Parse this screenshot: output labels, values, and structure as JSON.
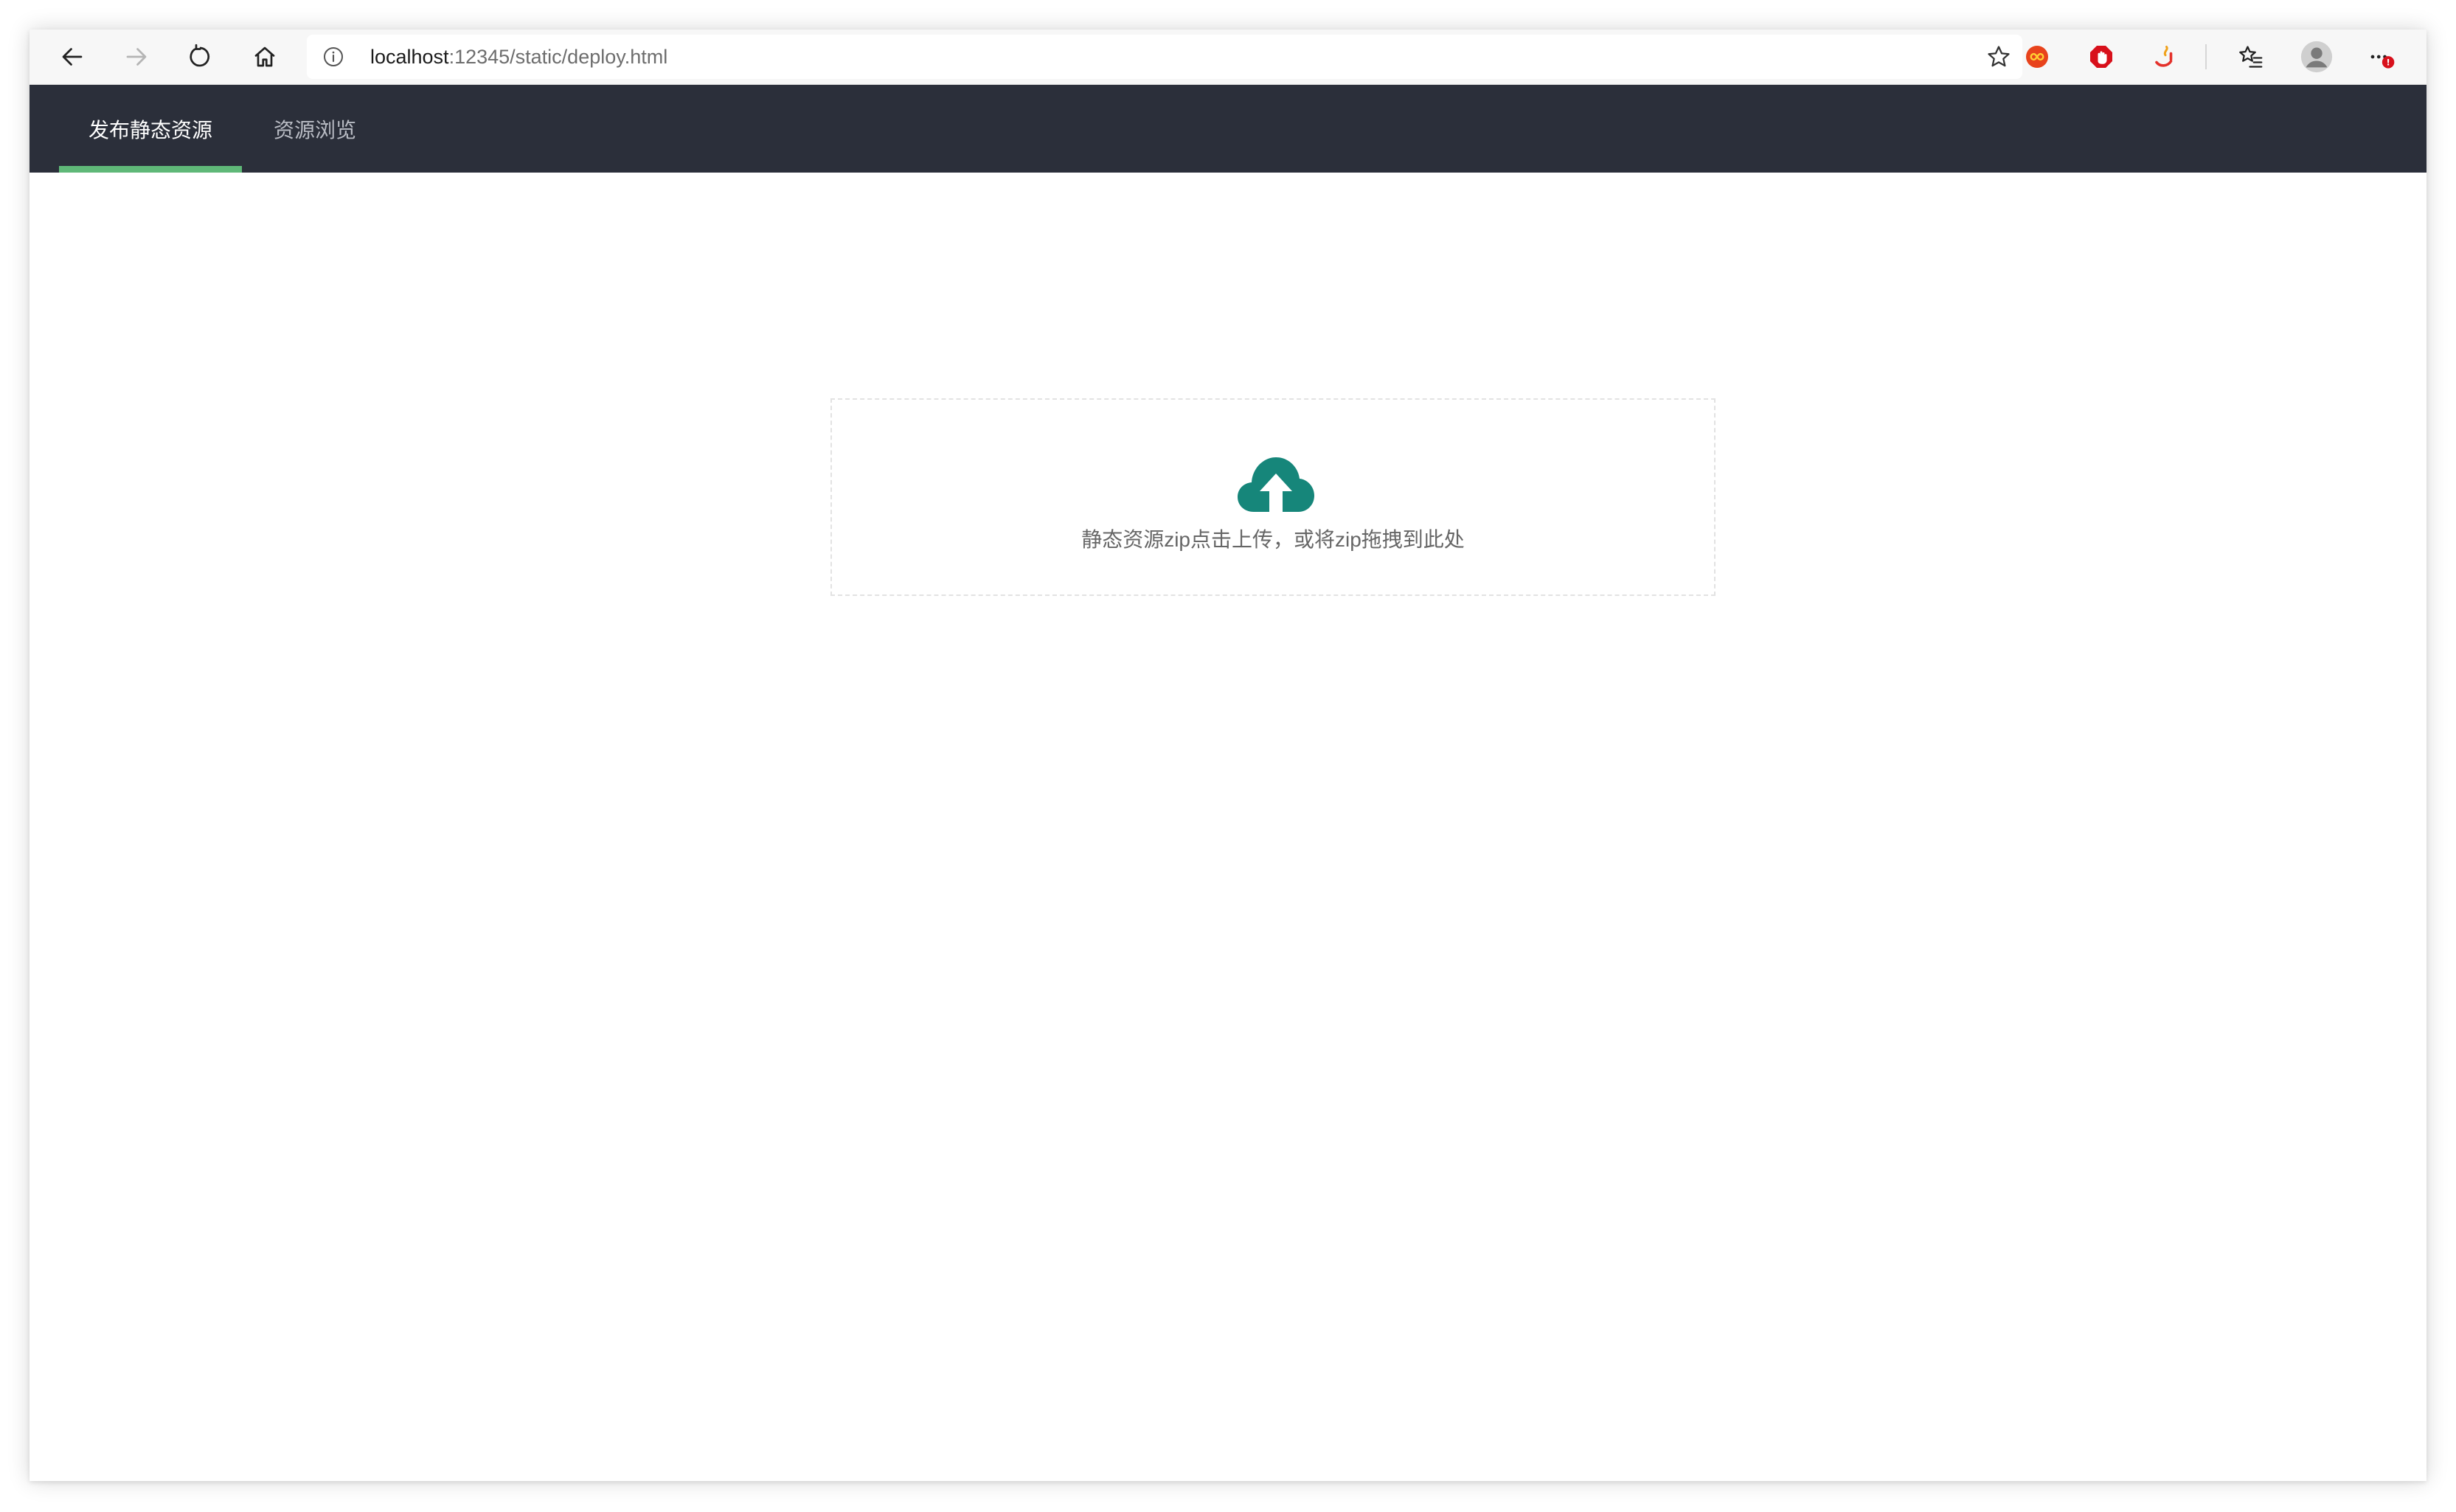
{
  "browser": {
    "url_host": "localhost",
    "url_path": ":12345/static/deploy.html",
    "icons": {
      "back": "arrow-left-icon",
      "forward": "arrow-right-icon",
      "reload": "reload-icon",
      "home": "home-icon",
      "info": "info-icon",
      "bookmark": "star-icon",
      "extension_1": "infinity-extension-icon",
      "extension_2": "adblock-extension-icon",
      "extension_3": "java-extension-icon",
      "favorites": "favorites-icon",
      "profile": "profile-avatar-icon",
      "menu": "more-menu-icon"
    },
    "notification_badge": "!"
  },
  "nav": {
    "tabs": [
      {
        "label": "发布静态资源",
        "active": true
      },
      {
        "label": "资源浏览",
        "active": false
      }
    ],
    "background_color": "#2b2f3a",
    "indicator_color": "#5fb878"
  },
  "upload": {
    "icon": "cloud-upload-icon",
    "icon_color": "#16867a",
    "text": "静态资源zip点击上传，或将zip拖拽到此处"
  }
}
